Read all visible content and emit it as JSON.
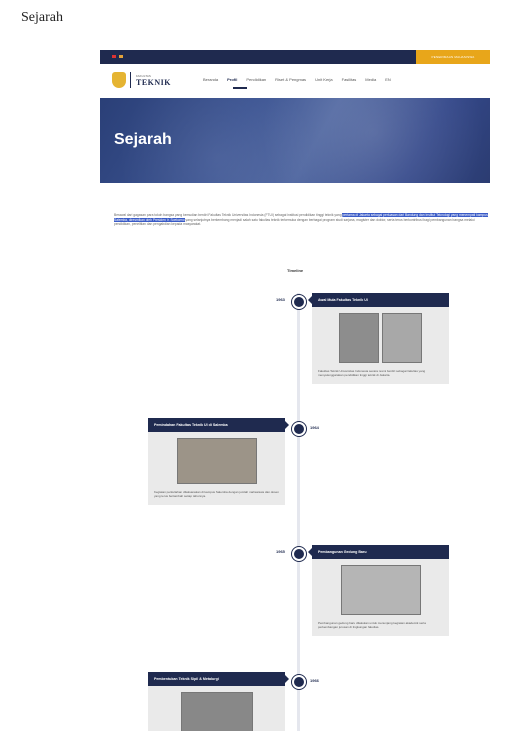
{
  "doc": {
    "heading": "Sejarah"
  },
  "topbar": {
    "cta": "PENERIMAAN MAHASISWA"
  },
  "logo": {
    "small": "FAKULTAS",
    "text": "TEKNIK"
  },
  "nav": {
    "items": [
      "Beranda",
      "Profil",
      "Pendidikan",
      "Riset & Pengmas",
      "Unit Kerja",
      "Fasilitas",
      "Media",
      "EN"
    ]
  },
  "hero": {
    "title": "Sejarah"
  },
  "intro": {
    "pre": "Berawal dari gagasan para tokoh bangsa yang kemudian berdiri Fakultas Teknik Universitas Indonesia (FTUI) sebagai institusi pendidikan tinggi teknik yang ",
    "highlight": "pertama di Jakarta sebagai perluasan dari Bandung dan Institut Teknologi yang menempati kampus Salemba, diresmikan oleh Presiden Ir. Soekarno",
    "post": " yang selanjutnya berkembang menjadi salah satu fakultas teknik terkemuka dengan berbagai program studi sarjana, magister dan doktor, serta terus berkontribusi bagi pembangunan bangsa melalui pendidikan, penelitian dan pengabdian kepada masyarakat."
  },
  "timeline": {
    "title": "Timeline",
    "events": [
      {
        "year": "1963",
        "title": "Awal Mula Fakultas Teknik UI",
        "text": "Fakultas Teknik Universitas Indonesia secara resmi berdiri sebagai fakultas yang menyelenggarakan pendidikan tinggi teknik di Jakarta."
      },
      {
        "year": "1964",
        "title": "Pemindahan Fakultas Teknik UI di Salemba",
        "text": "Kegiatan perkuliahan dilaksanakan di kampus Salemba dengan jumlah mahasiswa dan dosen yang terus bertambah setiap tahunnya."
      },
      {
        "year": "1965",
        "title": "Pembangunan Gedung Baru",
        "text": "Pembangunan gedung baru dilakukan untuk menunjang kegiatan akademik serta perkembangan jurusan di lingkungan fakultas."
      },
      {
        "year": "1966",
        "title": "Pembentukan Teknik Sipil & Metalurgi",
        "text": ""
      }
    ]
  }
}
